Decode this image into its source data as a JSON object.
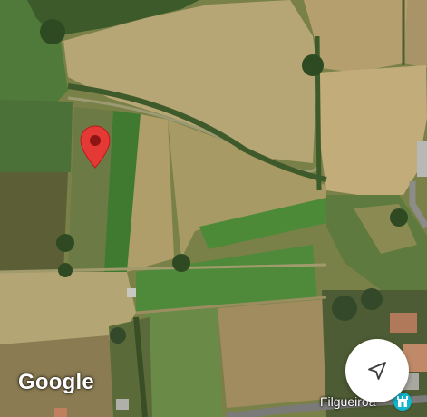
{
  "map": {
    "attribution": "Google",
    "place_label": "Filgueiroa"
  },
  "icons": {
    "pin": "location-pin",
    "locate": "navigation-arrow",
    "place": "tourist-attraction"
  },
  "colors": {
    "pin": "#e53935",
    "place_icon": "#12b5cb",
    "button": "#ffffff"
  }
}
